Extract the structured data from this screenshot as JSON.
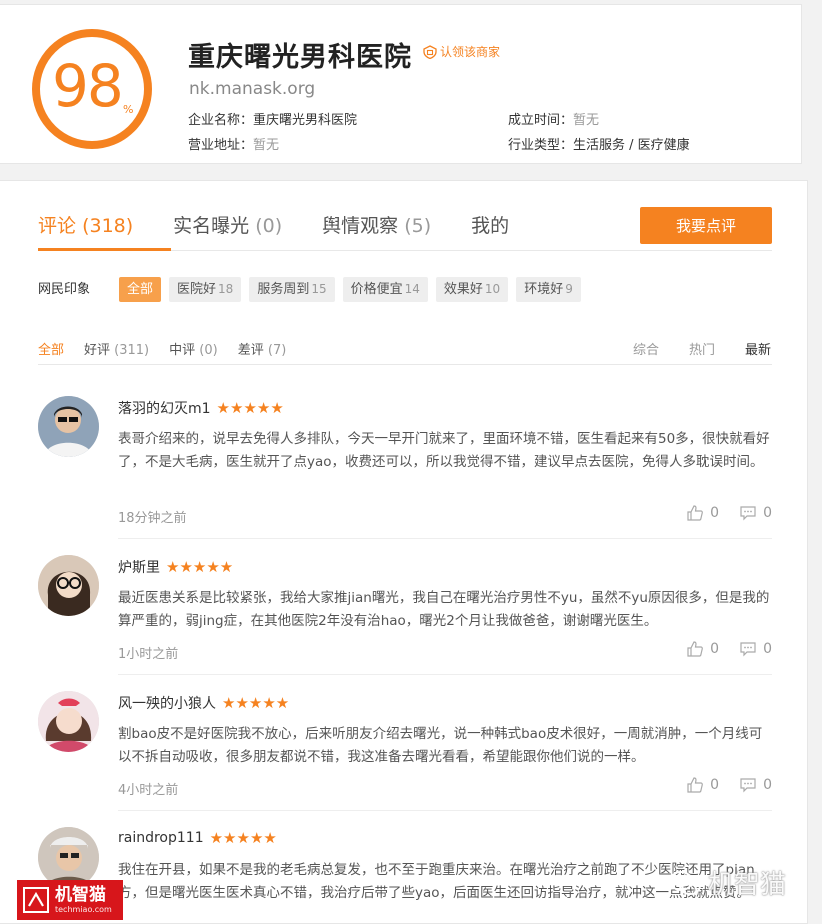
{
  "header": {
    "score": "98",
    "score_unit": "%",
    "hospital_name": "重庆曙光男科医院",
    "claim_label": "认领该商家",
    "domain": "nk.manask.org",
    "company_label": "企业名称：",
    "company_value": "重庆曙光男科医院",
    "address_label": "营业地址：",
    "address_value": "暂无",
    "founded_label": "成立时间：",
    "founded_value": "暂无",
    "industry_label": "行业类型：",
    "industry_value": "生活服务 / 医疗健康"
  },
  "tabs": [
    {
      "label": "评论",
      "count": "(318)"
    },
    {
      "label": "实名曝光",
      "count": "(0)"
    },
    {
      "label": "舆情观察",
      "count": "(5)"
    },
    {
      "label": "我的",
      "count": ""
    }
  ],
  "review_button": "我要点评",
  "impression": {
    "label": "网民印象",
    "tags": [
      {
        "label": "全部",
        "count": ""
      },
      {
        "label": "医院好",
        "count": "18"
      },
      {
        "label": "服务周到",
        "count": "15"
      },
      {
        "label": "价格便宜",
        "count": "14"
      },
      {
        "label": "效果好",
        "count": "10"
      },
      {
        "label": "环境好",
        "count": "9"
      }
    ]
  },
  "filters": [
    {
      "label": "全部",
      "count": ""
    },
    {
      "label": "好评",
      "count": "(311)"
    },
    {
      "label": "中评",
      "count": "(0)"
    },
    {
      "label": "差评",
      "count": "(7)"
    }
  ],
  "sorts": [
    "综合",
    "热门",
    "最新"
  ],
  "comments": [
    {
      "user": "落羽的幻灭m1",
      "rating": 5,
      "text": "表哥介绍来的，说早去免得人多排队，今天一早开门就来了，里面环境不错，医生看起来有50多，很快就看好了，不是大毛病，医生就开了点yao，收费还可以，所以我觉得不错，建议早点去医院，免得人多耽误时间。",
      "time": "18分钟之前",
      "likes": "0",
      "replies": "0"
    },
    {
      "user": "炉斯里",
      "rating": 5,
      "text": "最近医患关系是比较紧张，我给大家推jian曙光，我自己在曙光治疗男性不yu，虽然不yu原因很多，但是我的算严重的，弱jing症，在其他医院2年没有治hao，曙光2个月让我做爸爸，谢谢曙光医生。",
      "time": "1小时之前",
      "likes": "0",
      "replies": "0"
    },
    {
      "user": "风一殃的小狼人",
      "rating": 5,
      "text": "割bao皮不是好医院我不放心，后来听朋友介绍去曙光，说一种韩式bao皮术很好，一周就消肿，一个月线可以不拆自动吸收，很多朋友都说不错，我这准备去曙光看看，希望能跟你他们说的一样。",
      "time": "4小时之前",
      "likes": "0",
      "replies": "0"
    },
    {
      "user": "raindrop111",
      "rating": 5,
      "text": "我住在开县，如果不是我的老毛病总复发，也不至于跑重庆来治。在曙光治疗之前跑了不少医院还用了pian方，但是曙光医生医术真心不错，我治疗后带了些yao，后面医生还回访指导治疗，就冲这一点我就点赞。",
      "time": "",
      "likes": "",
      "replies": ""
    }
  ],
  "watermarks": {
    "left_main": "机智猫",
    "left_sub": "techmiao.com",
    "right": "机智猫"
  },
  "colors": {
    "accent": "#f58220",
    "tag_active": "#f7a04b",
    "watermark_red": "#d7161b"
  },
  "icons": [
    "claim-icon",
    "thumbs-up-icon",
    "comment-icon",
    "star-icon"
  ]
}
